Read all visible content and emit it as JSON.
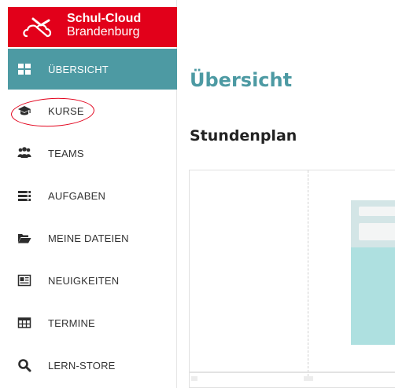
{
  "brand": {
    "line1": "Schul-Cloud",
    "line2": "Brandenburg",
    "color": "#e2001a"
  },
  "sidebar": {
    "active_color": "#4d9aa3",
    "items": [
      {
        "label": "ÜBERSICHT",
        "icon": "dashboard-icon",
        "active": true
      },
      {
        "label": "KURSE",
        "icon": "graduation-cap-icon",
        "active": false
      },
      {
        "label": "TEAMS",
        "icon": "users-icon",
        "active": false
      },
      {
        "label": "AUFGABEN",
        "icon": "tasks-icon",
        "active": false
      },
      {
        "label": "MEINE DATEIEN",
        "icon": "folder-open-icon",
        "active": false
      },
      {
        "label": "NEUIGKEITEN",
        "icon": "newspaper-icon",
        "active": false
      },
      {
        "label": "TERMINE",
        "icon": "calendar-table-icon",
        "active": false
      },
      {
        "label": "LERN-STORE",
        "icon": "search-icon",
        "active": false
      }
    ]
  },
  "main": {
    "title": "Übersicht",
    "section_title": "Stundenplan"
  }
}
